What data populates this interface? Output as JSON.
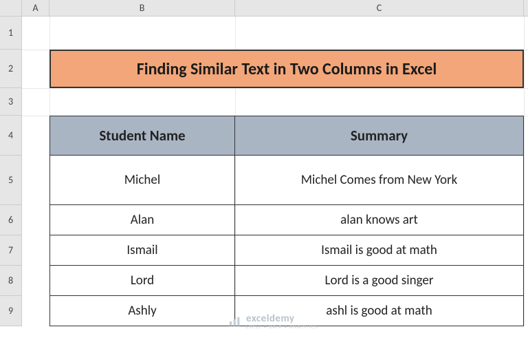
{
  "columns": {
    "A": "A",
    "B": "B",
    "C": "C"
  },
  "rownums": [
    "1",
    "2",
    "3",
    "4",
    "5",
    "6",
    "7",
    "8",
    "9"
  ],
  "title": "Finding Similar Text in Two Columns in Excel",
  "headers": {
    "col1": "Student Name",
    "col2": "Summary"
  },
  "rows": [
    {
      "name": "Michel",
      "summary": "Michel Comes from New York"
    },
    {
      "name": "Alan",
      "summary": "alan knows art"
    },
    {
      "name": "Ismail",
      "summary": "Ismail is good at math"
    },
    {
      "name": "Lord",
      "summary": "Lord is a good singer"
    },
    {
      "name": "Ashly",
      "summary": "ashl is good at math"
    }
  ],
  "watermark": {
    "main": "exceldemy",
    "sub": "EXCEL • DATA • ANALYTICS"
  }
}
